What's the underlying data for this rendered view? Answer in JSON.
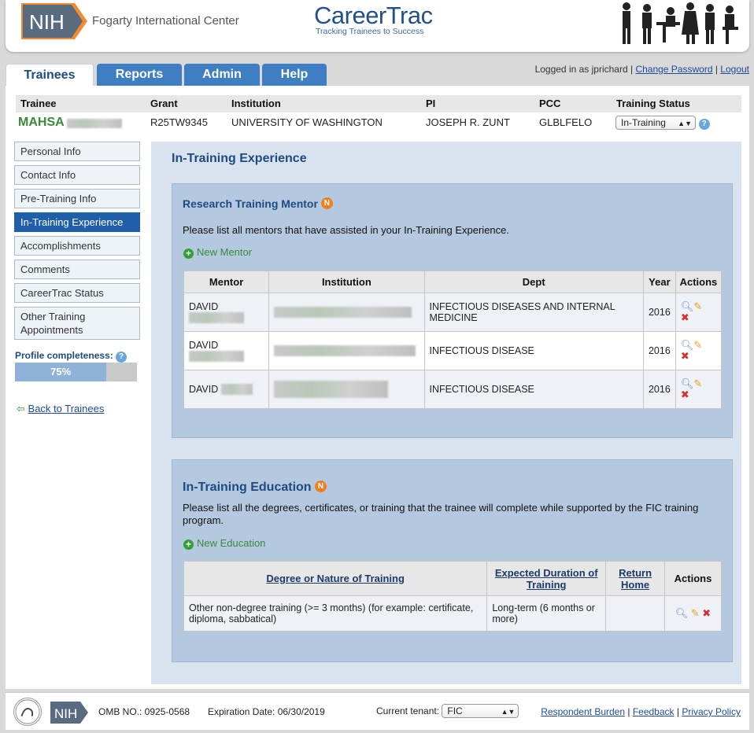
{
  "header": {
    "nih_logo_text": "NIH",
    "org_name": "Fogarty International Center",
    "app_title": "CareerTrac",
    "app_tagline": "Tracking Trainees to Success"
  },
  "tabs": [
    {
      "label": "Trainees",
      "active": true
    },
    {
      "label": "Reports",
      "active": false
    },
    {
      "label": "Admin",
      "active": false
    },
    {
      "label": "Help",
      "active": false
    }
  ],
  "login": {
    "text": "Logged in as jprichard",
    "change_password": "Change Password",
    "logout": "Logout"
  },
  "trainee_table": {
    "headers": [
      "Trainee",
      "Grant",
      "Institution",
      "PI",
      "PCC",
      "Training Status"
    ],
    "trainee_name": "MAHSA",
    "grant": "R25TW9345",
    "institution": "UNIVERSITY OF WASHINGTON",
    "pi": "JOSEPH R. ZUNT",
    "pcc": "GLBLFELO",
    "training_status": "In-Training"
  },
  "sidebar": {
    "items": [
      {
        "label": "Personal Info",
        "active": false
      },
      {
        "label": "Contact Info",
        "active": false
      },
      {
        "label": "Pre-Training Info",
        "active": false
      },
      {
        "label": "In-Training Experience",
        "active": true
      },
      {
        "label": "Accomplishments",
        "active": false
      },
      {
        "label": "Comments",
        "active": false
      },
      {
        "label": "CareerTrac Status",
        "active": false
      },
      {
        "label": "Other Training Appointments",
        "active": false
      }
    ],
    "completeness_label": "Profile completeness:",
    "completeness_value": "75%",
    "completeness_fraction": 0.75,
    "back_link": "Back to Trainees"
  },
  "content": {
    "title": "In-Training Experience",
    "mentor_section": {
      "title": "Research Training Mentor",
      "badge": "N",
      "instructions": "Please list all mentors that have assisted in your In-Training Experience.",
      "new_link": "New Mentor",
      "columns": [
        "Mentor",
        "Institution",
        "Dept",
        "Year",
        "Actions"
      ],
      "rows": [
        {
          "mentor": "DAVID",
          "dept": "INFECTIOUS DISEASES AND INTERNAL MEDICINE",
          "year": "2016"
        },
        {
          "mentor": "DAVID",
          "dept": "INFECTIOUS DISEASE",
          "year": "2016"
        },
        {
          "mentor": "DAVID",
          "dept": "INFECTIOUS DISEASE",
          "year": "2016"
        }
      ]
    },
    "education_section": {
      "title": "In-Training Education",
      "badge": "N",
      "instructions": "Please list all the degrees, certificates, or training that the trainee will complete while supported by the FIC training program.",
      "new_link": "New Education",
      "columns": [
        "Degree or Nature of Training",
        "Expected Duration of Training",
        "Return Home",
        "Actions"
      ],
      "rows": [
        {
          "degree": "Other non-degree training (>= 3 months) (for example: certificate, diploma, sabbatical)",
          "duration": "Long-term (6 months or more)",
          "return_home": ""
        }
      ]
    }
  },
  "footer": {
    "nih_text": "NIH",
    "omb": "OMB NO.: 0925-0568",
    "expiration": "Expiration Date: 06/30/2019",
    "tenant_label": "Current tenant:",
    "tenant_value": "FIC",
    "respondent_burden": "Respondent Burden",
    "feedback": "Feedback",
    "privacy": "Privacy Policy"
  },
  "colors": {
    "primary_blue": "#1e4a82",
    "tab_blue": "#3f7ec3",
    "panel_blue": "#b4c9df",
    "green": "#3a8a3a",
    "orange_badge": "#f07f22"
  }
}
